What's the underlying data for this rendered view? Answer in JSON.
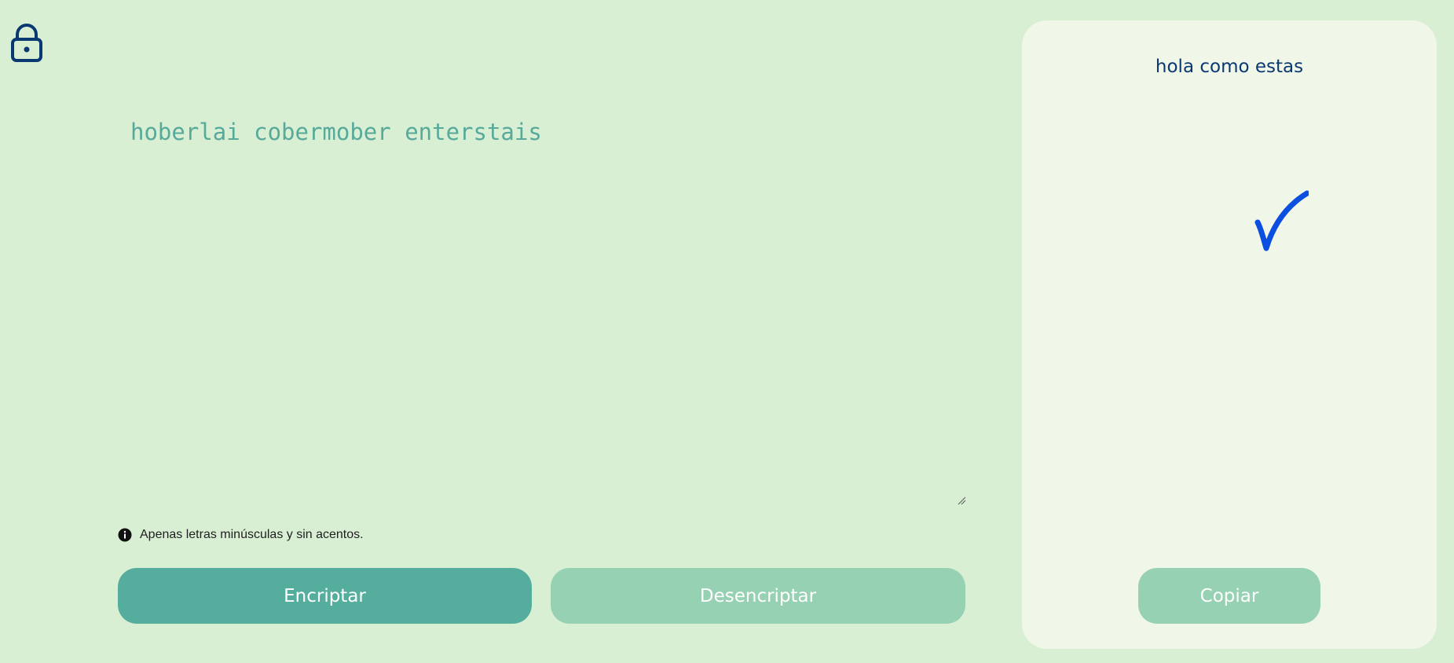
{
  "logo": {
    "icon": "lock-icon",
    "color": "#0A3871"
  },
  "input": {
    "value": "hoberlai cobermober enterstais",
    "text_color": "#57A99A"
  },
  "info": {
    "icon": "info-circle-icon",
    "text": "Apenas letras minúsculas y sin acentos."
  },
  "buttons": {
    "encrypt_label": "Encriptar",
    "decrypt_label": "Desencriptar",
    "copy_label": "Copiar"
  },
  "output": {
    "text": "hola como estas",
    "status_icon": "checkmark-icon"
  },
  "colors": {
    "background": "#D8EFD4",
    "panel": "#F1F7E8",
    "primary": "#0A3871",
    "accent_dark": "#55AE9D",
    "accent_light": "#96D1B4",
    "check": "#0B4FE0"
  }
}
